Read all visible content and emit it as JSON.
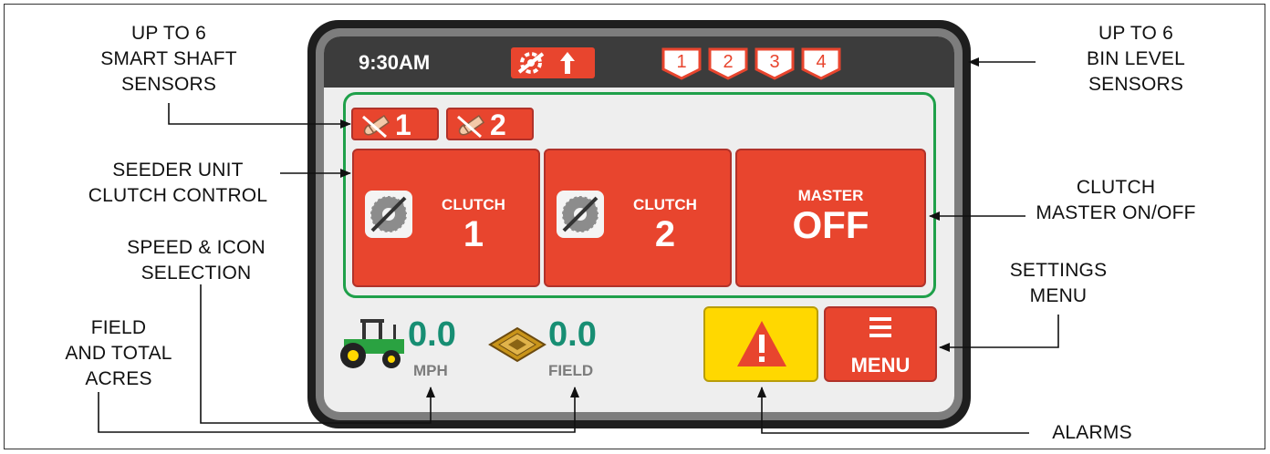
{
  "callouts": {
    "smart_shaft": [
      "UP TO 6",
      "SMART SHAFT",
      "SENSORS"
    ],
    "seeder_clutch": [
      "SEEDER UNIT",
      "CLUTCH CONTROL"
    ],
    "speed_icon": [
      "SPEED & ICON",
      "SELECTION"
    ],
    "field_acres": [
      "FIELD",
      "AND TOTAL",
      "ACRES"
    ],
    "bin_level": [
      "UP TO 6",
      "BIN LEVEL",
      "SENSORS"
    ],
    "clutch_master": [
      "CLUTCH",
      "MASTER ON/OFF"
    ],
    "settings_menu": [
      "SETTINGS",
      "MENU"
    ],
    "alarms": [
      "ALARMS"
    ]
  },
  "status_bar": {
    "time": "9:30AM",
    "bins": [
      "1",
      "2",
      "3",
      "4"
    ]
  },
  "shaft_sensors": [
    "1",
    "2"
  ],
  "clutches": [
    {
      "label": "CLUTCH",
      "number": "1"
    },
    {
      "label": "CLUTCH",
      "number": "2"
    }
  ],
  "master": {
    "label": "MASTER",
    "state": "OFF"
  },
  "speed": {
    "value": "0.0",
    "unit": "MPH"
  },
  "field": {
    "value": "0.0",
    "unit": "FIELD"
  },
  "menu": {
    "label": "MENU"
  },
  "icons": [
    "shaft-sensor-status-icon",
    "up-arrow-icon",
    "bin-level-icon",
    "shaft-sensor-icon",
    "clutch-disengaged-icon",
    "tractor-icon",
    "field-acres-icon",
    "warning-icon",
    "menu-icon"
  ],
  "colors": {
    "accent_red": "#e8452e",
    "green_border": "#1fa04a",
    "teal_value": "#178e73",
    "alarm_yellow": "#ffd800",
    "bezel": "#1e1e1e"
  }
}
